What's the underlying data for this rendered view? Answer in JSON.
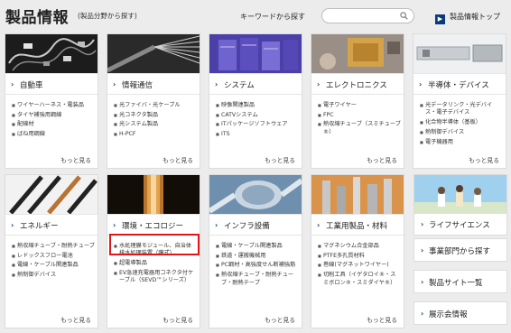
{
  "header": {
    "title": "製品情報",
    "subtitle": "(製品分野から探す)",
    "keyword_label": "キーワードから探す",
    "search_placeholder": "",
    "top_link": "製品情報トップ"
  },
  "cards": [
    {
      "id": "automotive",
      "label": "自動車",
      "items": [
        "ワイヤーハーネス・電装品",
        "タイヤ補強用鋼線",
        "配線材",
        "ばね用鋼線"
      ],
      "more": "もっと見る"
    },
    {
      "id": "infocomm",
      "label": "情報通信",
      "items": [
        "光ファイバ・光ケーブル",
        "光コネクタ製品",
        "光システム製品",
        "H-PCF"
      ],
      "more": "もっと見る"
    },
    {
      "id": "systems",
      "label": "システム",
      "items": [
        "映像関連製品",
        "CATVシステム",
        "ITパッケージソフトウェア",
        "ITS"
      ],
      "more": "もっと見る"
    },
    {
      "id": "electronics",
      "label": "エレクトロニクス",
      "items": [
        "電子ワイヤー",
        "FPC",
        "熱収縮チューブ（スミチューブ®）"
      ],
      "more": "もっと見る"
    },
    {
      "id": "semiconductor",
      "label": "半導体・デバイス",
      "items": [
        "光データリンク・光デバイス・電子デバイス",
        "化合物半導体（基板）",
        "熱制御デバイス",
        "電子機器用"
      ],
      "more": "もっと見る"
    },
    {
      "id": "energy",
      "label": "エネルギー",
      "items": [
        "熱収縮チューブ・耐熱チューブ",
        "レドックスフロー電池",
        "電線・ケーブル関連製品",
        "熱制御デバイス"
      ],
      "more": "もっと見る"
    },
    {
      "id": "environment",
      "label": "環境・エコロジー",
      "items": [
        "水処理膜モジュール、自治体排水処理装置（膜式）",
        "超電導製品",
        "EV急速充電器用コネクタ付ケーブル（SEVD™シリーズ）"
      ],
      "more": "もっと見る"
    },
    {
      "id": "infrastructure",
      "label": "インフラ設備",
      "items": [
        "電線・ケーブル関連製品",
        "鉄道・運搬機械用",
        "PC鋼材・高強度せん断補強筋",
        "熱収縮チューブ・耐熱チューブ・耐熱テープ"
      ],
      "more": "もっと見る"
    },
    {
      "id": "industrial",
      "label": "工業用製品・材料",
      "items": [
        "マグネシウム合金部品",
        "PTFE多孔質材料",
        "巻線(マグネットワイヤー)",
        "切削工具（イゲタロイ®・スミボロン®・スミダイヤ®）"
      ],
      "more": "もっと見る"
    }
  ],
  "side_links": [
    {
      "id": "life-science",
      "label": "ライフサイエンス"
    },
    {
      "id": "by-division",
      "label": "事業部門から探す"
    },
    {
      "id": "product-sites",
      "label": "製品サイト一覧"
    },
    {
      "id": "exhibitions",
      "label": "展示会情報"
    }
  ]
}
